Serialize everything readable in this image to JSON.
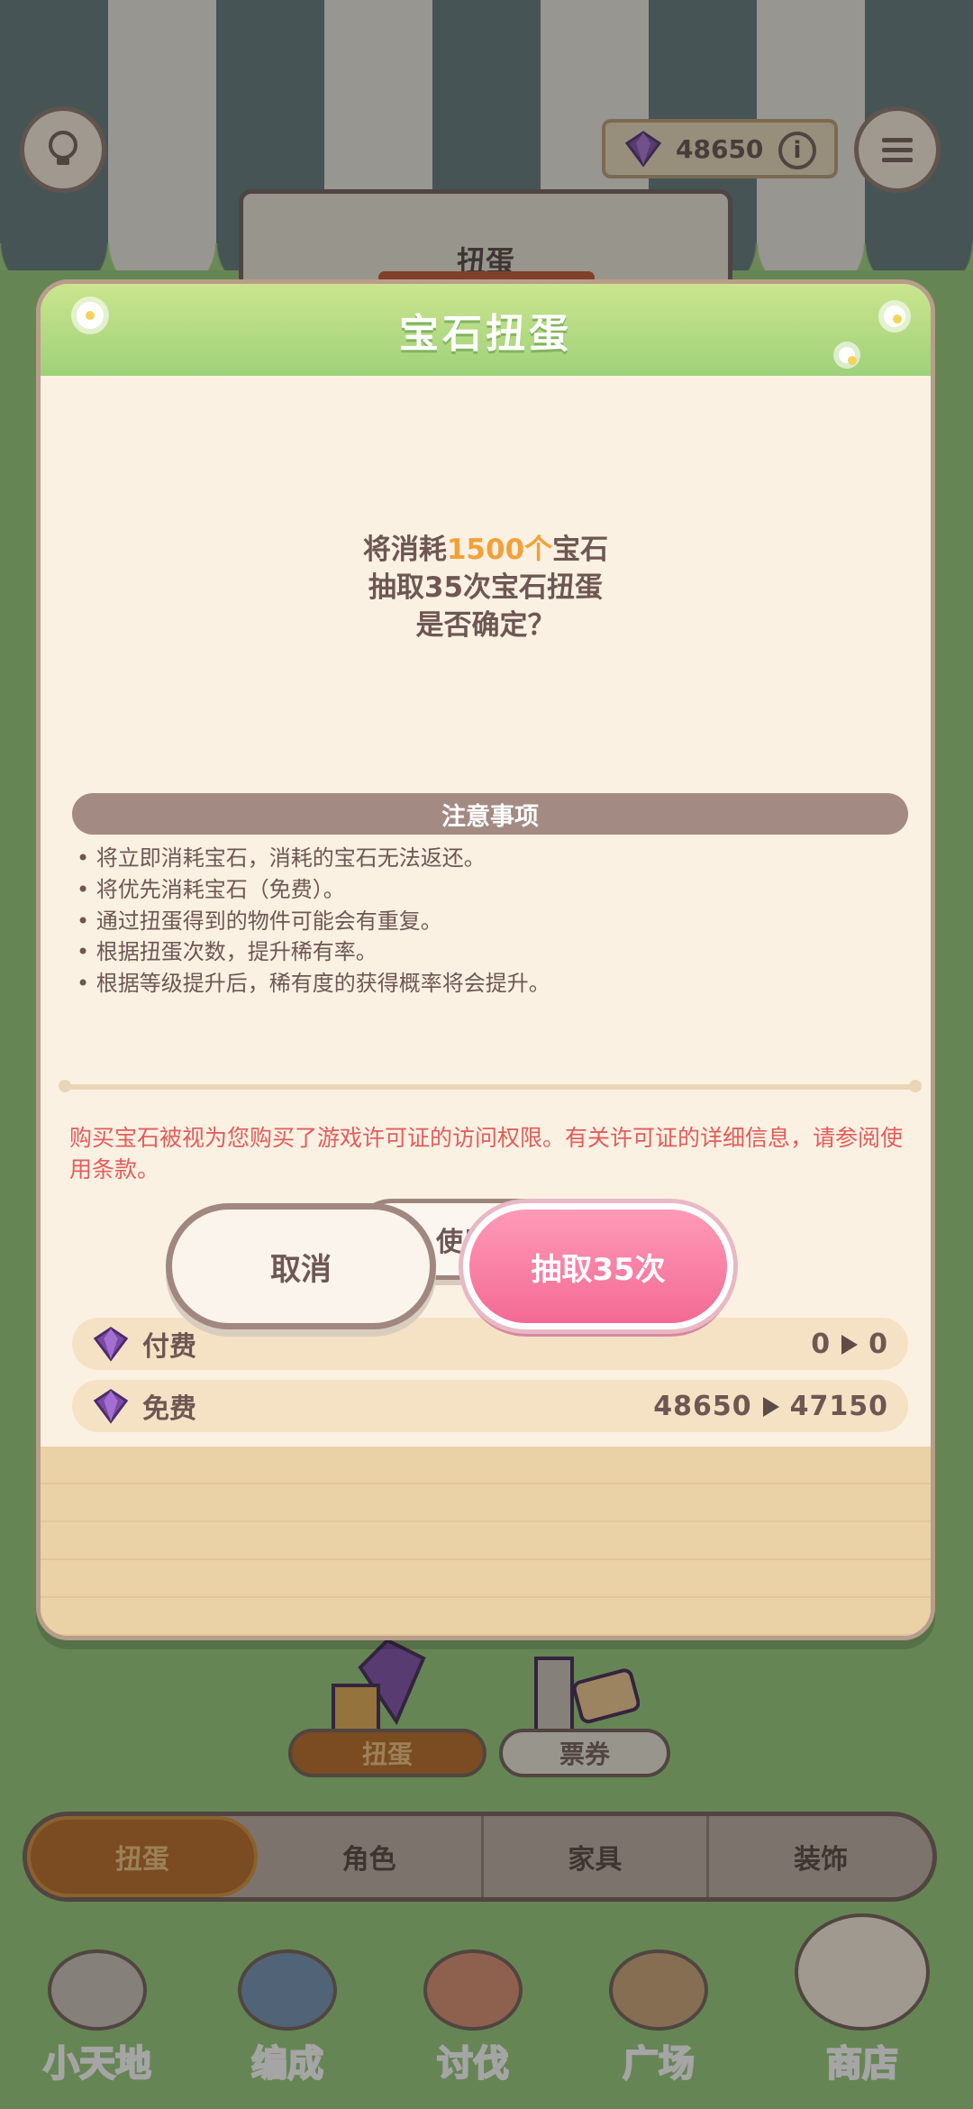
{
  "header": {
    "gem_count": "48650",
    "sign_title": "扭蛋"
  },
  "modal": {
    "title": "宝石扭蛋",
    "confirm": {
      "line1_prefix": "将消耗",
      "line1_amount": "1500个",
      "line1_suffix": "宝石",
      "line2": "抽取35次宝石扭蛋",
      "line3": "是否确定？"
    },
    "notice_title": "注意事项",
    "notices": [
      "将立即消耗宝石，消耗的宝石无法返还。",
      "将优先消耗宝石（免费）。",
      "通过扭蛋得到的物件可能会有重复。",
      "根据扭蛋次数，提升稀有率。",
      "根据等级提升后，稀有度的获得概率将会提升。"
    ],
    "law_text": "购买宝石被视为您购买了游戏许可证的访问权限。有关许可证的详细信息，请参阅使用条款。",
    "terms_button": "使用条款",
    "paid_label": "付费",
    "paid_from": "0",
    "paid_to": "0",
    "free_label": "免费",
    "free_from": "48650",
    "free_to": "47150",
    "cancel_button": "取消",
    "draw_button": "抽取35次"
  },
  "sub_tabs": [
    "扭蛋",
    "票券"
  ],
  "tabs": [
    "扭蛋",
    "角色",
    "家具",
    "装饰"
  ],
  "nav": [
    "小天地",
    "编成",
    "讨伐",
    "广场",
    "商店"
  ],
  "colors": {
    "accent_pink": "#f36a94",
    "highlight_orange": "#f2a13a",
    "warning_red": "#e35d5d",
    "header_green": "#9fd17a"
  }
}
